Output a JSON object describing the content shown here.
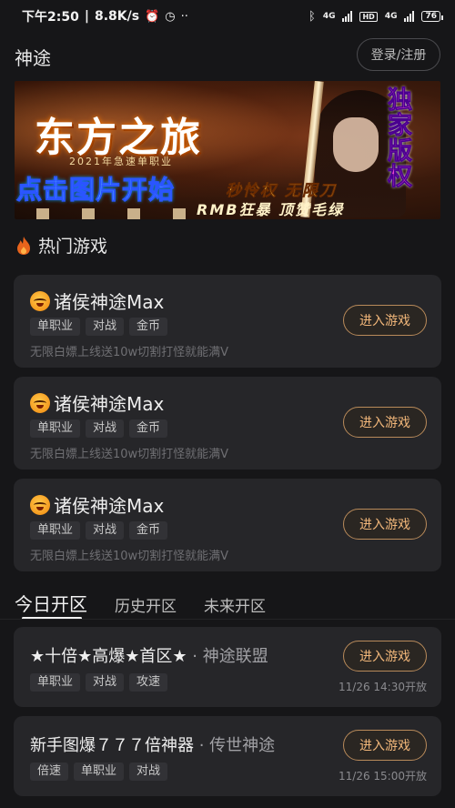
{
  "status_bar": {
    "time": "下午2:50",
    "net_speed": "8.8K/s",
    "network_1": "4G",
    "hd": "HD",
    "network_2": "4G",
    "battery": "76"
  },
  "header": {
    "title": "神途",
    "login_label": "登录/注册"
  },
  "banner": {
    "logo_text": "东方之旅",
    "sub_text": "2021年急速单职业",
    "cta": "点击图片开始",
    "exclusive": "独家版权",
    "slogan_1": "秒怜权 无限刀",
    "slogan_2": "RMB狂暴 顶赞毛绿"
  },
  "hot_section": {
    "title": "热门游戏",
    "icon": "fire-icon",
    "accent": "#e8641c"
  },
  "hot_games": [
    {
      "name": "诸侯神途Max",
      "tags": [
        "单职业",
        "对战",
        "金币"
      ],
      "desc": "无限白嫖上线送10w切割打怪就能满V",
      "button": "进入游戏"
    },
    {
      "name": "诸侯神途Max",
      "tags": [
        "单职业",
        "对战",
        "金币"
      ],
      "desc": "无限白嫖上线送10w切割打怪就能满V",
      "button": "进入游戏"
    },
    {
      "name": "诸侯神途Max",
      "tags": [
        "单职业",
        "对战",
        "金币"
      ],
      "desc": "无限白嫖上线送10w切割打怪就能满V",
      "button": "进入游戏"
    }
  ],
  "server_tabs": [
    "今日开区",
    "历史开区",
    "未来开区"
  ],
  "active_tab": "今日开区",
  "servers": [
    {
      "name": "★十倍★高爆★首区★",
      "group": "· 神途联盟",
      "tags": [
        "单职业",
        "对战",
        "攻速"
      ],
      "button": "进入游戏",
      "time": "11/26 14:30开放"
    },
    {
      "name": "新手图爆７７７倍神器",
      "group": "· 传世神途",
      "tags": [
        "倍速",
        "单职业",
        "对战"
      ],
      "button": "进入游戏",
      "time": "11/26 15:00开放"
    }
  ],
  "colors": {
    "background": "#161618",
    "card": "#262629",
    "button_text": "#f2b77a",
    "button_border": "#b88a5a"
  }
}
